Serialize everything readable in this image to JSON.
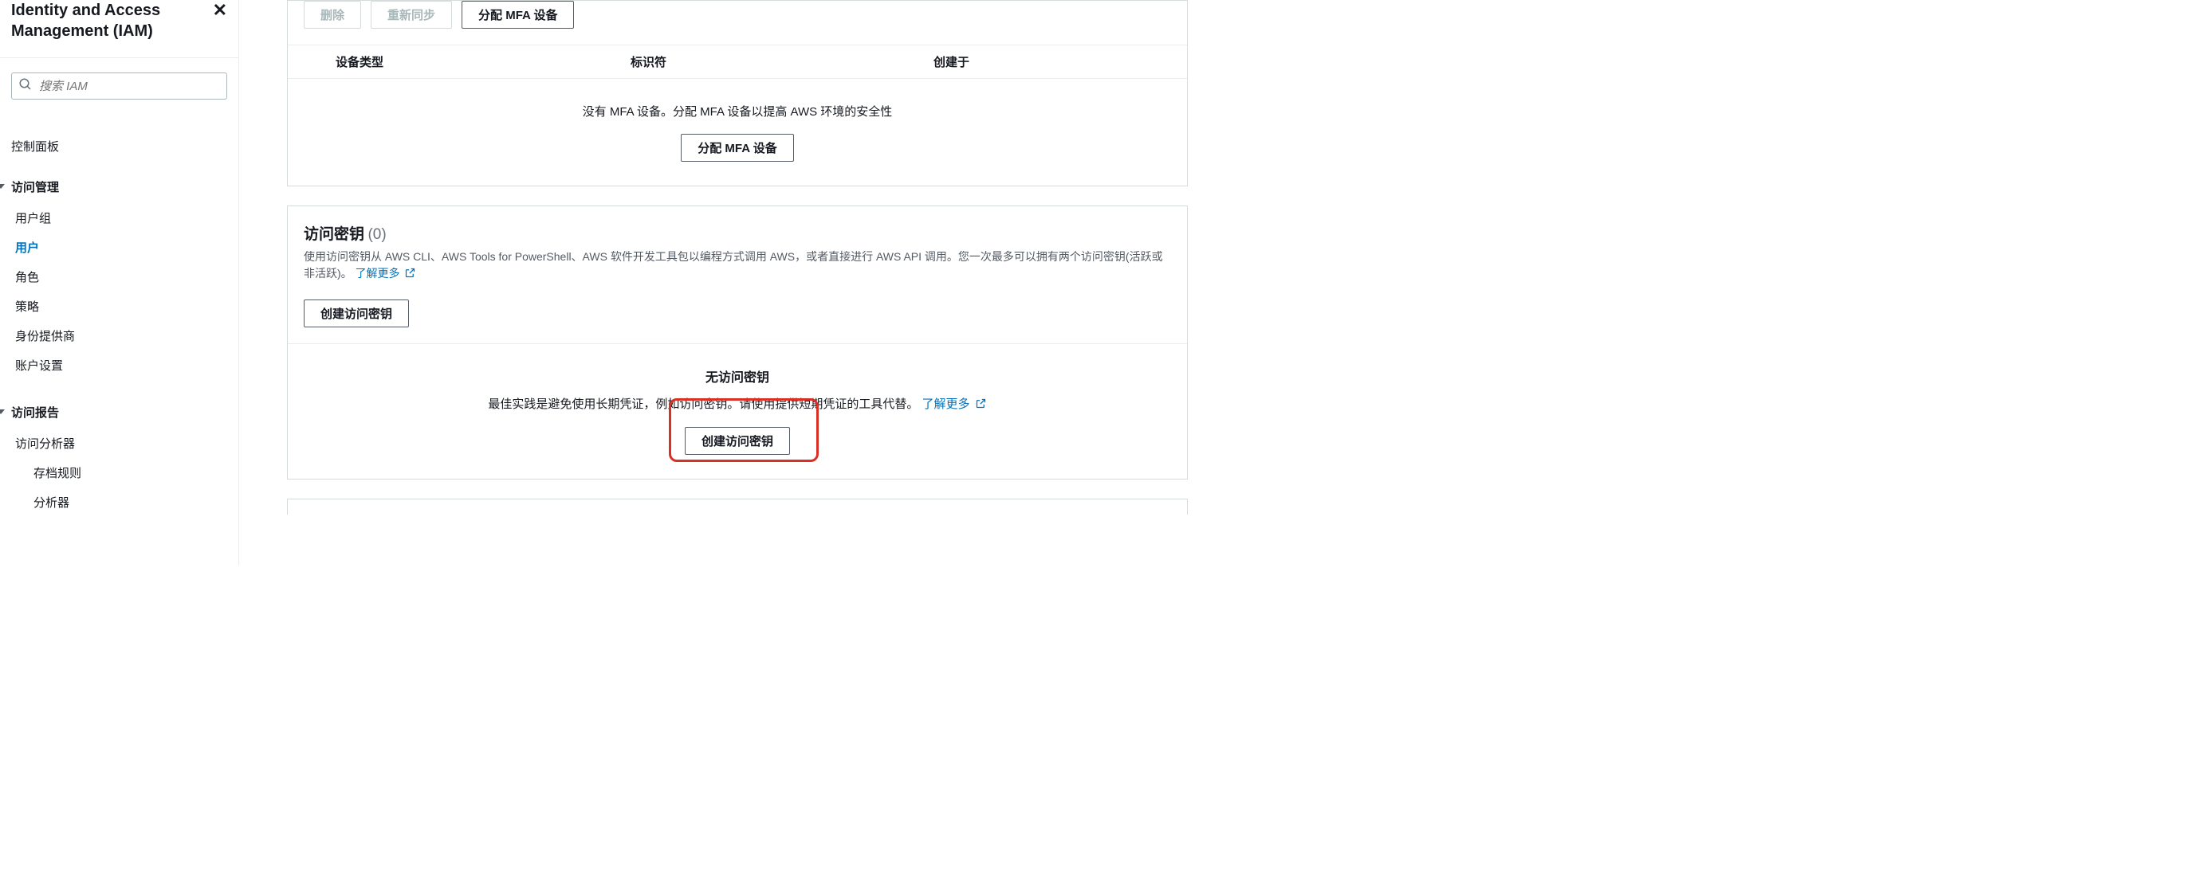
{
  "sidebar": {
    "title": "Identity and Access Management (IAM)",
    "search_placeholder": "搜索 IAM",
    "dashboard": "控制面板",
    "group_access": "访问管理",
    "items_access": [
      "用户组",
      "用户",
      "角色",
      "策略",
      "身份提供商",
      "账户设置"
    ],
    "active_index": 1,
    "group_report": "访问报告",
    "items_report": [
      "访问分析器"
    ],
    "sub_report": [
      "存档规则",
      "分析器"
    ]
  },
  "mfa": {
    "btn_delete": "删除",
    "btn_resync": "重新同步",
    "btn_assign": "分配 MFA 设备",
    "col_device": "设备类型",
    "col_identifier": "标识符",
    "col_created": "创建于",
    "empty_text": "没有 MFA 设备。分配 MFA 设备以提高 AWS 环境的安全性",
    "btn_assign2": "分配 MFA 设备"
  },
  "ak": {
    "title": "访问密钥",
    "count": "(0)",
    "desc": "使用访问密钥从 AWS CLI、AWS Tools for PowerShell、AWS 软件开发工具包以编程方式调用 AWS，或者直接进行 AWS API 调用。您一次最多可以拥有两个访问密钥(活跃或非活跃)。",
    "learn_more": "了解更多",
    "btn_create_top": "创建访问密钥",
    "empty_title": "无访问密钥",
    "empty_desc": "最佳实践是避免使用长期凭证，例如访问密钥。请使用提供短期凭证的工具代替。",
    "empty_learn_more": "了解更多",
    "btn_create": "创建访问密钥"
  }
}
